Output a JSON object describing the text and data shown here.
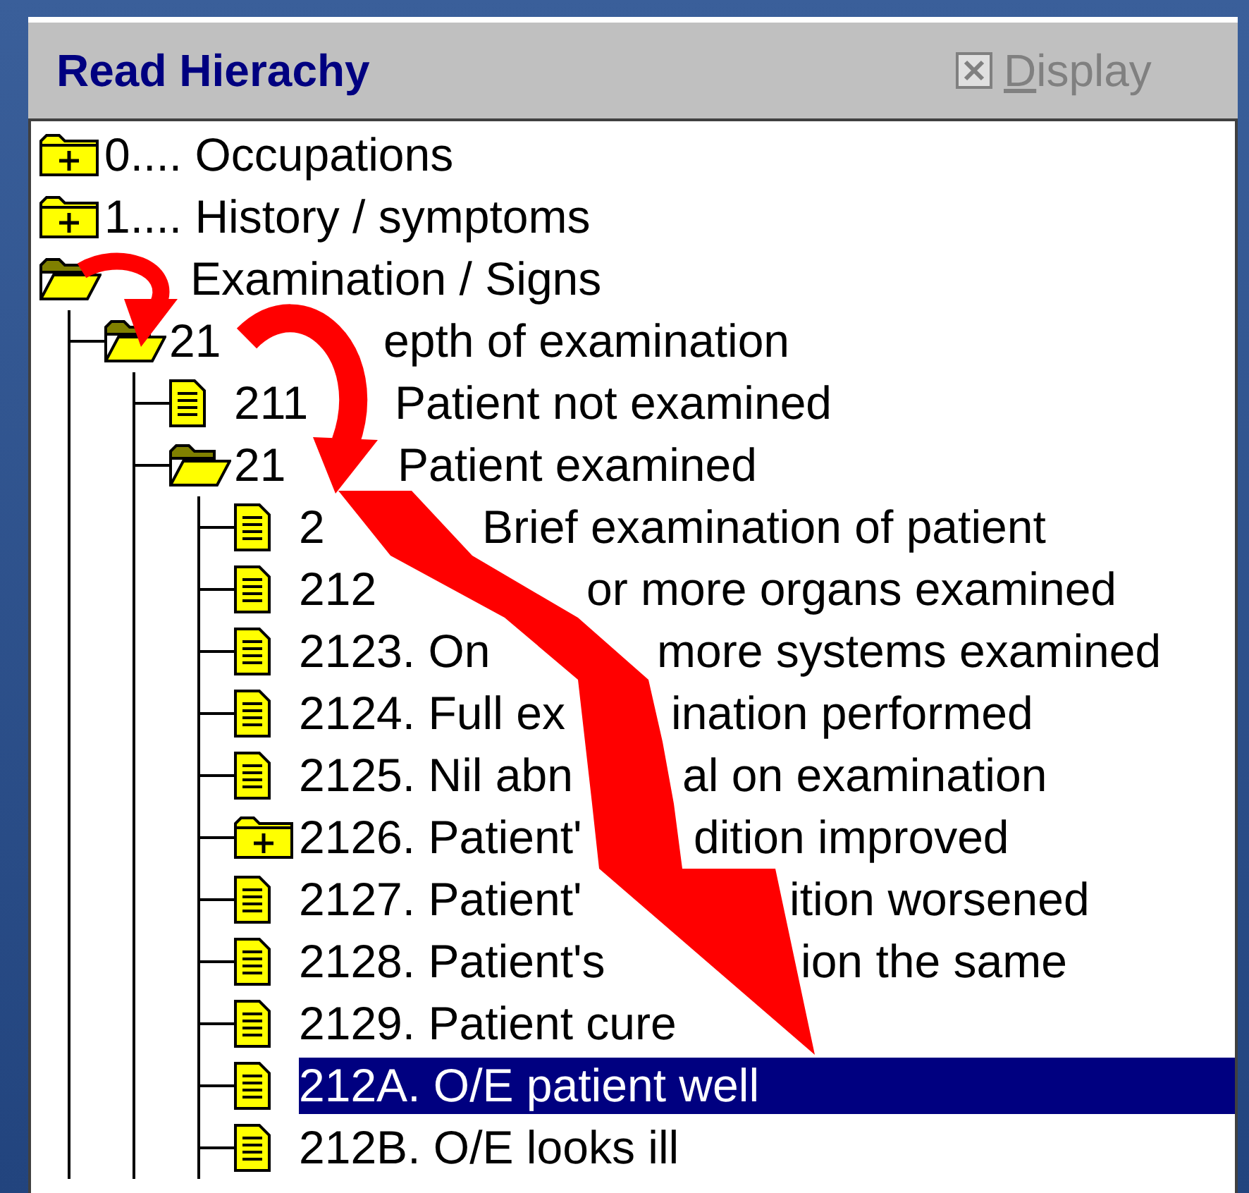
{
  "panel": {
    "title": "Read Hierachy",
    "option": {
      "label": "Display",
      "checked": true,
      "disabled": true
    }
  },
  "tree": [
    {
      "label": [
        "0.... Occupations"
      ],
      "kind": "folder",
      "expanded": false,
      "selected": false
    },
    {
      "label": [
        "1.... History / symptoms"
      ],
      "kind": "folder",
      "expanded": false,
      "selected": false
    },
    {
      "label": [
        "Examination / Signs"
      ],
      "kind": "folder",
      "expanded": true,
      "selected": false,
      "children": [
        {
          "label": [
            "21",
            "epth of examination"
          ],
          "kind": "folder",
          "expanded": true,
          "selected": false,
          "children": [
            {
              "label": [
                "211",
                "Patient not examined"
              ],
              "kind": "document",
              "selected": false
            },
            {
              "label": [
                "21",
                "Patient examined"
              ],
              "kind": "folder",
              "expanded": true,
              "selected": false,
              "children": [
                {
                  "label": [
                    "2",
                    "Brief examination of patient"
                  ],
                  "kind": "document",
                  "selected": false
                },
                {
                  "label": [
                    "212",
                    "or more organs examined"
                  ],
                  "kind": "document",
                  "selected": false
                },
                {
                  "label": [
                    "2123. On",
                    "more systems examined"
                  ],
                  "kind": "document",
                  "selected": false
                },
                {
                  "label": [
                    "2124. Full ex",
                    "ination performed"
                  ],
                  "kind": "document",
                  "selected": false
                },
                {
                  "label": [
                    "2125. Nil abn",
                    "al on examination"
                  ],
                  "kind": "document",
                  "selected": false
                },
                {
                  "label": [
                    "2126. Patient'",
                    "dition improved"
                  ],
                  "kind": "folder",
                  "expanded": false,
                  "selected": false
                },
                {
                  "label": [
                    "2127. Patient'",
                    "ition worsened"
                  ],
                  "kind": "document",
                  "selected": false
                },
                {
                  "label": [
                    "2128. Patient's",
                    "ion the same"
                  ],
                  "kind": "document",
                  "selected": false
                },
                {
                  "label": [
                    "2129. Patient cure"
                  ],
                  "kind": "document",
                  "selected": false
                },
                {
                  "label": [
                    "212A. O/E patient well"
                  ],
                  "kind": "document",
                  "selected": true
                },
                {
                  "label": [
                    "212B. O/E looks ill"
                  ],
                  "kind": "document",
                  "selected": false
                }
              ]
            }
          ]
        }
      ]
    }
  ]
}
